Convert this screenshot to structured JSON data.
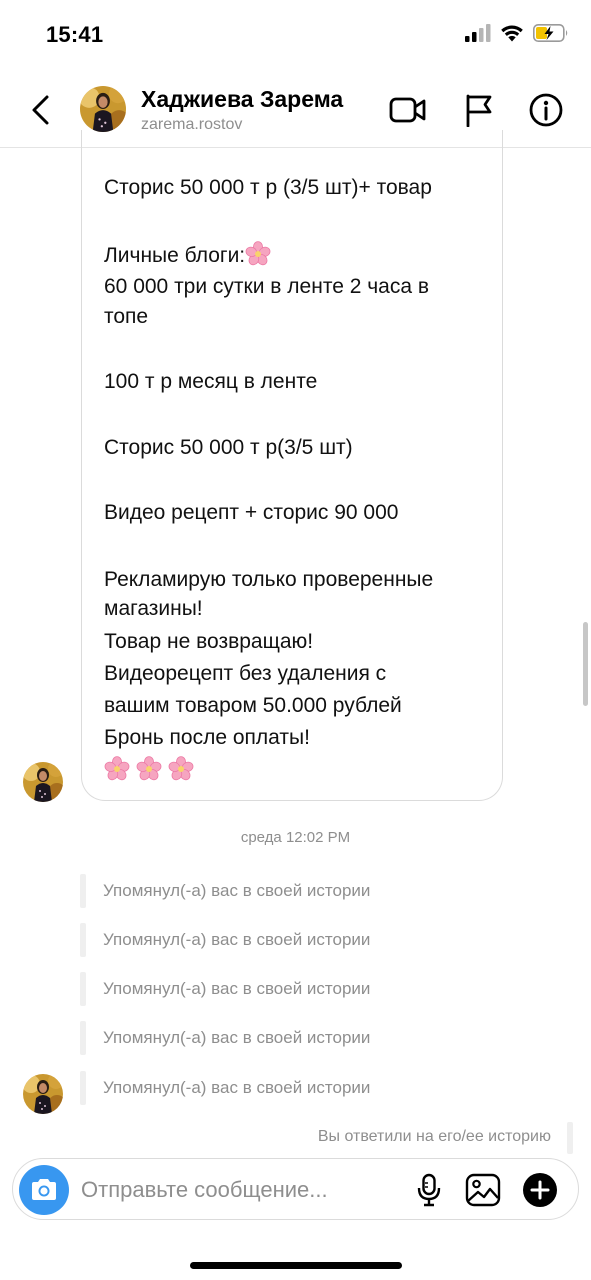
{
  "status_bar": {
    "time": "15:41"
  },
  "header": {
    "name": "Хаджиева Зарема",
    "username": "zarema.rostov"
  },
  "message": {
    "lines": [
      "Сторис 50 000 т р (3/5 шт)+ товар",
      "Личные блоги:",
      "60 000  три сутки в ленте 2 часа в",
      "топе",
      "100 т р месяц в ленте",
      "Сторис 50 000 т р(3/5 шт)",
      "Видео рецепт + сторис 90 000",
      "Рекламирую только проверенные",
      "магазины!",
      " Товар не возвращаю!",
      "Видеорецепт без удаления с",
      "вашим товаром  50.000 рублей",
      "Бронь после оплаты!"
    ]
  },
  "timestamp": "среда 12:02 PM",
  "mentions": [
    "Упомянул(-а) вас в своей истории",
    "Упомянул(-а) вас в своей истории",
    "Упомянул(-а) вас в своей истории",
    "Упомянул(-а) вас в своей истории",
    "Упомянул(-а) вас в своей истории"
  ],
  "reply_note": "Вы ответили на его/ее историю",
  "composer": {
    "placeholder": "Отправьте сообщение..."
  },
  "colors": {
    "accent": "#3897f0",
    "secondary_text": "#8e8e8e",
    "border": "#dbdbdb",
    "flower": "#f48fb1"
  },
  "icons": [
    "back-icon",
    "video-call-icon",
    "flag-icon",
    "info-icon",
    "camera-icon",
    "microphone-icon",
    "gallery-icon",
    "plus-icon",
    "cherry-blossom-icon"
  ]
}
